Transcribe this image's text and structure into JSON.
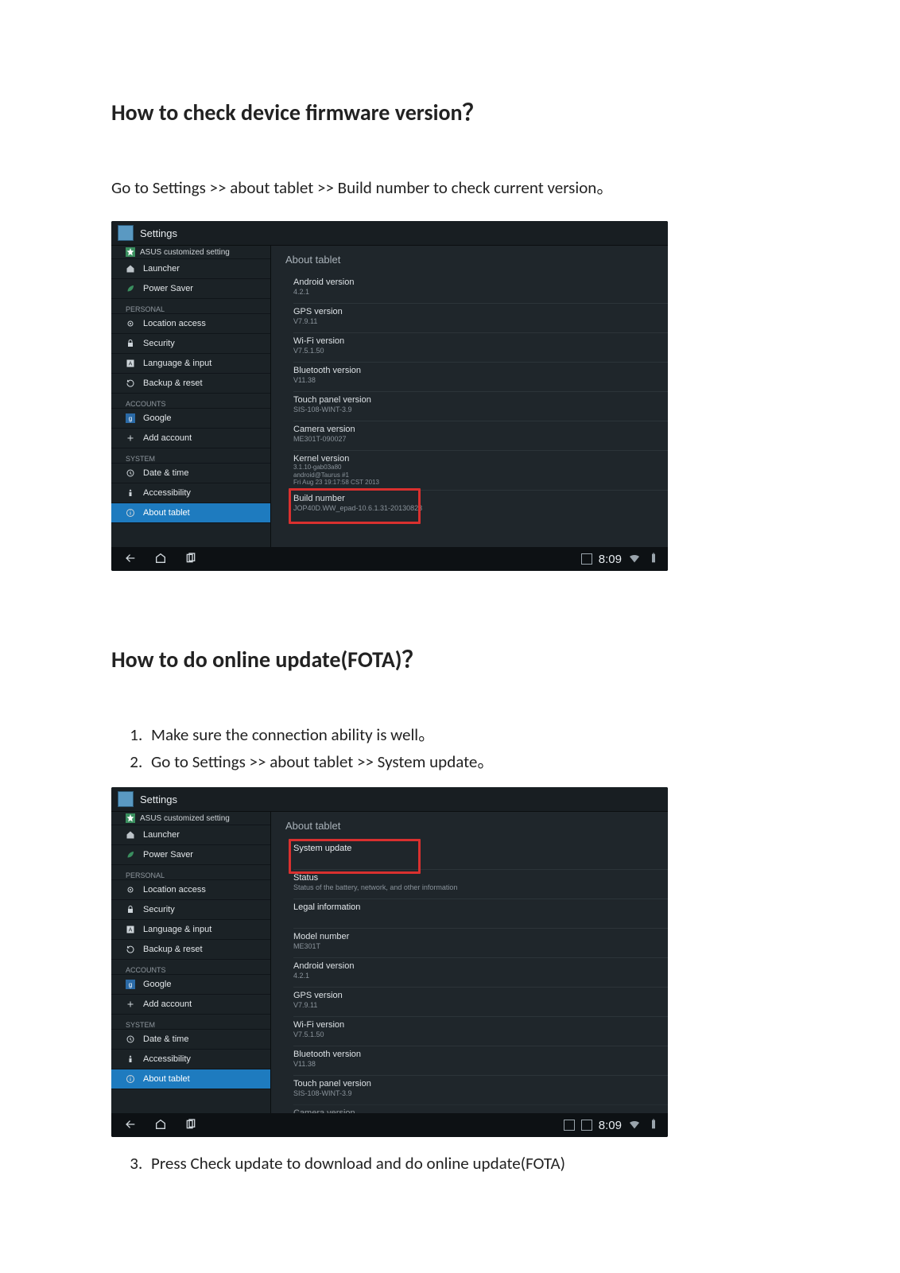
{
  "doc": {
    "heading1": "How to check device firmware version？",
    "intro1": "Go to Settings >> about tablet >> Build number to check current version。",
    "heading2": "How to do online update(FOTA)？",
    "steps": [
      "Make sure the connection ability is well。",
      "Go to Settings >> about tablet >> System update。"
    ],
    "step3": "Press Check update to download and do online update(FOTA)"
  },
  "shot_common": {
    "title": "Settings",
    "truncated_top": "ASUS customized setting",
    "sidebar": [
      {
        "name": "launcher",
        "label": "Launcher",
        "icon": "home"
      },
      {
        "name": "power-saver",
        "label": "Power Saver",
        "icon": "leaf"
      }
    ],
    "personal_header": "PERSONAL",
    "personal": [
      {
        "name": "location-access",
        "label": "Location access",
        "icon": "target"
      },
      {
        "name": "security",
        "label": "Security",
        "icon": "lock"
      },
      {
        "name": "language-input",
        "label": "Language & input",
        "icon": "a-box"
      },
      {
        "name": "backup-reset",
        "label": "Backup & reset",
        "icon": "refresh"
      }
    ],
    "accounts_header": "ACCOUNTS",
    "accounts": [
      {
        "name": "google",
        "label": "Google",
        "icon": "google"
      },
      {
        "name": "add-account",
        "label": "Add account",
        "icon": "plus"
      }
    ],
    "system_header": "SYSTEM",
    "system": [
      {
        "name": "date-time",
        "label": "Date & time",
        "icon": "clock"
      },
      {
        "name": "accessibility",
        "label": "Accessibility",
        "icon": "hand"
      },
      {
        "name": "about-tablet",
        "label": "About tablet",
        "icon": "info",
        "selected": true
      }
    ],
    "detail_header": "About tablet",
    "navbar_clock": "8:09"
  },
  "shot1": {
    "rows": [
      {
        "key": "android",
        "label": "Android version",
        "value": "4.2.1"
      },
      {
        "key": "gps",
        "label": "GPS version",
        "value": "V7.9.11"
      },
      {
        "key": "wifi",
        "label": "Wi-Fi version",
        "value": "V7.5.1.50"
      },
      {
        "key": "bt",
        "label": "Bluetooth version",
        "value": "V11.38"
      },
      {
        "key": "touch",
        "label": "Touch panel version",
        "value": "SIS-108-WINT-3.9"
      },
      {
        "key": "camera",
        "label": "Camera version",
        "value": "ME301T-090027"
      },
      {
        "key": "kernel",
        "label": "Kernel version",
        "lines": [
          "3.1.10-gab03a80",
          "android@Taurus #1",
          "Fri Aug 23 19:17:58 CST 2013"
        ]
      },
      {
        "key": "build",
        "label": "Build number",
        "value": "JOP40D.WW_epad-10.6.1.31-20130823",
        "highlight": true
      }
    ]
  },
  "shot2": {
    "rows": [
      {
        "key": "sysupdate",
        "label": "System update",
        "clickable": true,
        "highlight": true
      },
      {
        "key": "status",
        "label": "Status",
        "value": "Status of the battery, network, and other information",
        "clickable": true
      },
      {
        "key": "legal",
        "label": "Legal information",
        "clickable": true
      },
      {
        "key": "model",
        "label": "Model number",
        "value": "ME301T"
      },
      {
        "key": "android",
        "label": "Android version",
        "value": "4.2.1"
      },
      {
        "key": "gps",
        "label": "GPS version",
        "value": "V7.9.11"
      },
      {
        "key": "wifi",
        "label": "Wi-Fi version",
        "value": "V7.5.1.50"
      },
      {
        "key": "bt",
        "label": "Bluetooth version",
        "value": "V11.38"
      },
      {
        "key": "touch",
        "label": "Touch panel version",
        "value": "SIS-108-WINT-3.9"
      },
      {
        "key": "camera",
        "label": "Camera version",
        "truncated": true
      }
    ]
  }
}
